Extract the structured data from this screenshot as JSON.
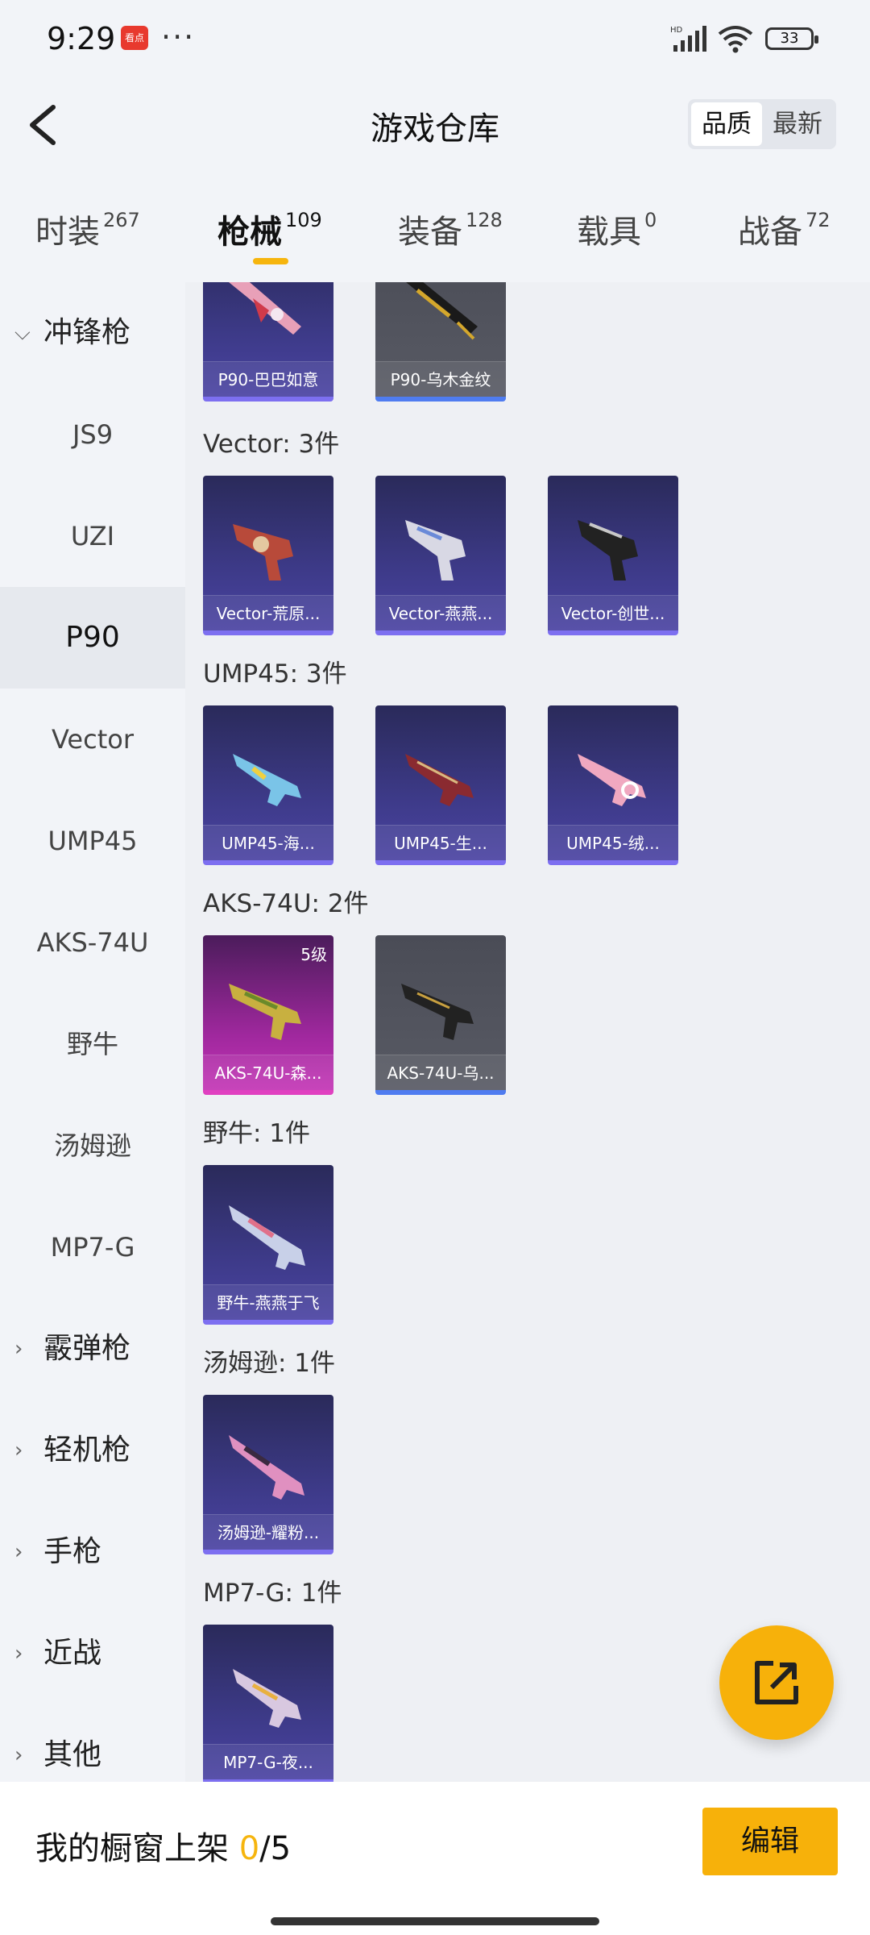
{
  "status_bar": {
    "time": "9:29",
    "notification": "看点",
    "more": "···",
    "battery": "33"
  },
  "header": {
    "title": "游戏仓库",
    "sort_quality": "品质",
    "sort_latest": "最新"
  },
  "tabs": [
    {
      "label": "时装",
      "count": "267"
    },
    {
      "label": "枪械",
      "count": "109"
    },
    {
      "label": "装备",
      "count": "128"
    },
    {
      "label": "载具",
      "count": "0"
    },
    {
      "label": "战备",
      "count": "72"
    }
  ],
  "active_tab": "枪械",
  "sidebar": {
    "categories": [
      "冲锋枪",
      "霰弹枪",
      "轻机枪",
      "手枪",
      "近战",
      "其他"
    ],
    "sub_items": [
      "JS9",
      "UZI",
      "P90",
      "Vector",
      "UMP45",
      "AKS-74U",
      "野牛",
      "汤姆逊",
      "MP7-G"
    ],
    "active": "P90"
  },
  "sections": [
    {
      "title": "",
      "items": [
        {
          "name": "P90-巴巴如意"
        },
        {
          "name": "P90-乌木金纹"
        }
      ]
    },
    {
      "title": "Vector: 3件",
      "items": [
        {
          "name": "Vector-荒原..."
        },
        {
          "name": "Vector-燕燕..."
        },
        {
          "name": "Vector-创世..."
        }
      ]
    },
    {
      "title": "UMP45: 3件",
      "items": [
        {
          "name": "UMP45-海..."
        },
        {
          "name": "UMP45-生..."
        },
        {
          "name": "UMP45-绒..."
        }
      ]
    },
    {
      "title": "AKS-74U: 2件",
      "items": [
        {
          "name": "AKS-74U-森...",
          "level": "5级"
        },
        {
          "name": "AKS-74U-乌..."
        }
      ]
    },
    {
      "title": "野牛: 1件",
      "items": [
        {
          "name": "野牛-燕燕于飞"
        }
      ]
    },
    {
      "title": "汤姆逊: 1件",
      "items": [
        {
          "name": "汤姆逊-耀粉..."
        }
      ]
    },
    {
      "title": "MP7-G: 1件",
      "items": [
        {
          "name": "MP7-G-夜..."
        }
      ]
    }
  ],
  "bottom": {
    "shelf_label": "我的橱窗上架 ",
    "shelf_count": "0",
    "shelf_total": "/5",
    "edit": "编辑"
  },
  "colors": {
    "accent": "#f7b10a",
    "card_purple": "#3d3a88",
    "card_gray": "#585a64",
    "card_pink": "#a0289e"
  }
}
